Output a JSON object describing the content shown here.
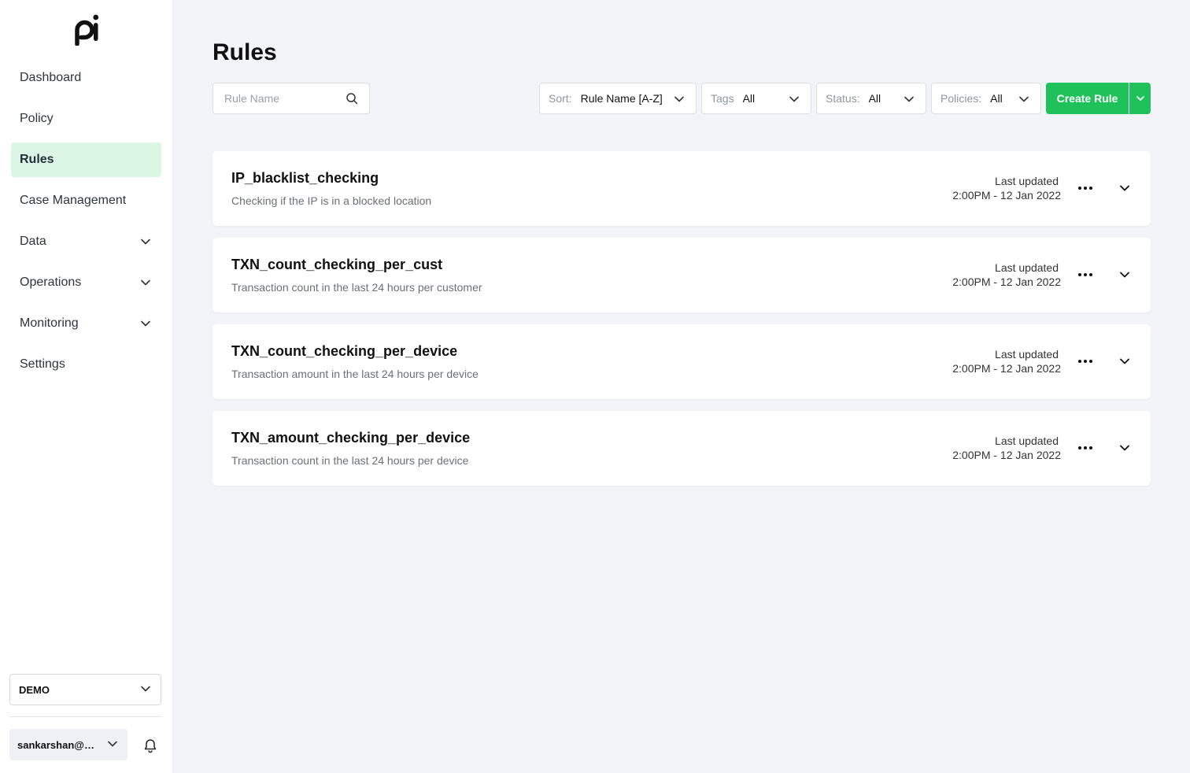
{
  "sidebar": {
    "logo_text": "pi",
    "items": [
      {
        "label": "Dashboard",
        "active": false,
        "expandable": false
      },
      {
        "label": "Policy",
        "active": false,
        "expandable": false
      },
      {
        "label": "Rules",
        "active": true,
        "expandable": false
      },
      {
        "label": "Case Management",
        "active": false,
        "expandable": false
      },
      {
        "label": "Data",
        "active": false,
        "expandable": true
      },
      {
        "label": "Operations",
        "active": false,
        "expandable": true
      },
      {
        "label": "Monitoring",
        "active": false,
        "expandable": true
      },
      {
        "label": "Settings",
        "active": false,
        "expandable": false
      }
    ],
    "environment": "DEMO",
    "user": "sankarshan@p..."
  },
  "page": {
    "title": "Rules"
  },
  "search": {
    "placeholder": "Rule Name",
    "value": ""
  },
  "filters": {
    "sort": {
      "label": "Sort:",
      "value": "Rule Name [A-Z]"
    },
    "tags": {
      "label": "Tags",
      "value": "All"
    },
    "status": {
      "label": "Status:",
      "value": "All"
    },
    "policies": {
      "label": "Policies:",
      "value": "All"
    }
  },
  "actions": {
    "create_rule": "Create Rule"
  },
  "rules": [
    {
      "name": "IP_blacklist_checking",
      "description": "Checking if the IP is in a blocked location",
      "updated_label": "Last updated",
      "updated_time": "2:00PM - 12 Jan 2022"
    },
    {
      "name": "TXN_count_checking_per_cust",
      "description": "Transaction count in the last 24 hours per customer",
      "updated_label": "Last updated",
      "updated_time": "2:00PM - 12 Jan 2022"
    },
    {
      "name": "TXN_count_checking_per_device",
      "description": "Transaction amount in the last 24 hours per device",
      "updated_label": "Last updated",
      "updated_time": "2:00PM - 12 Jan 2022"
    },
    {
      "name": "TXN_amount_checking_per_device",
      "description": "Transaction count in the last 24 hours per device",
      "updated_label": "Last updated",
      "updated_time": "2:00PM - 12 Jan 2022"
    }
  ],
  "colors": {
    "accent": "#1fc15a",
    "active_nav_bg": "#dcf6e5",
    "page_bg": "#f3f4f7"
  },
  "icons": {
    "search": "search-icon",
    "chevron": "chevron-down-icon",
    "more": "more-horizontal-icon",
    "bell": "bell-icon"
  }
}
